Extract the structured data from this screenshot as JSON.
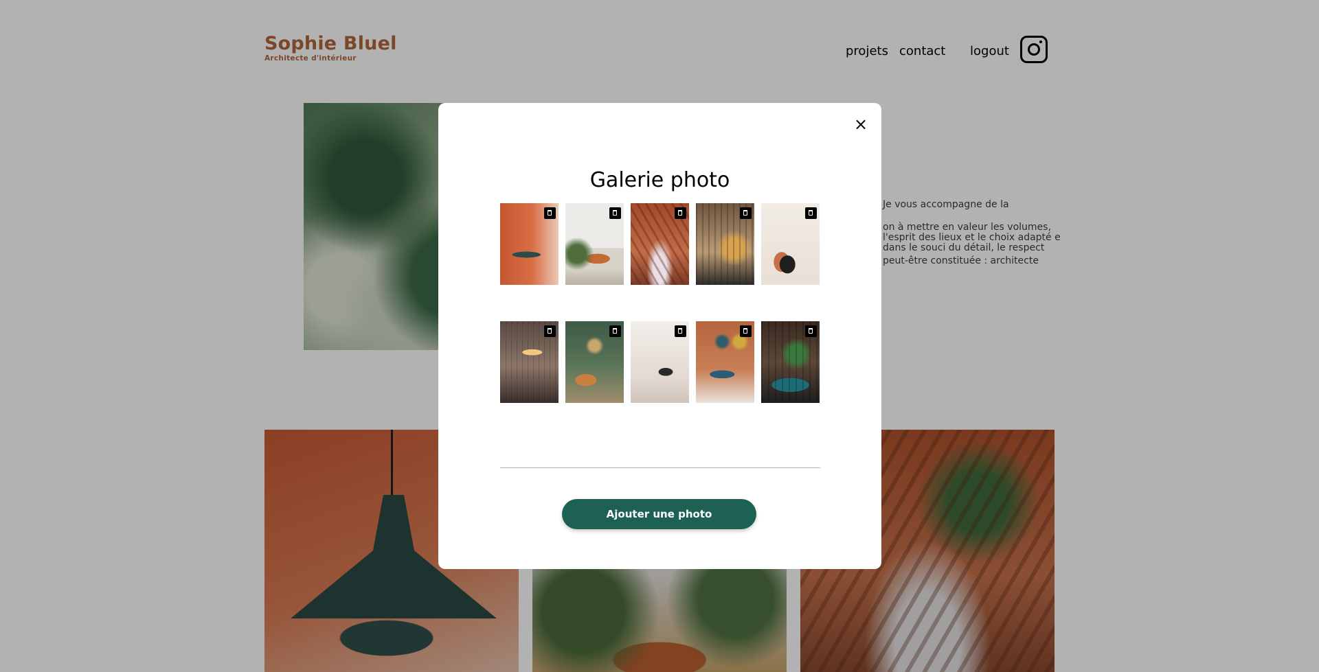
{
  "header": {
    "brand_title": "Sophie Bluel",
    "brand_subtitle": "Architecte d'intérieur",
    "nav": {
      "projets": "projets",
      "contact": "contact",
      "logout": "logout"
    },
    "instagram_icon": "instagram-icon"
  },
  "intro": {
    "paragraphs": [
      "Je vous accompagne de la",
      "on à mettre en valeur les volumes, l'esprit des lieux et le choix adapté e dans le souci du détail, le respect",
      "peut-être constituée : architecte"
    ]
  },
  "modal": {
    "close_label": "×",
    "title": "Galerie photo",
    "trash_icon": "trash-icon",
    "photo_count": 10,
    "add_button_label": "Ajouter une photo"
  },
  "colors": {
    "brand": "#b1663c",
    "button": "#1d6154",
    "overlay": "rgba(0,0,0,0.30)"
  }
}
